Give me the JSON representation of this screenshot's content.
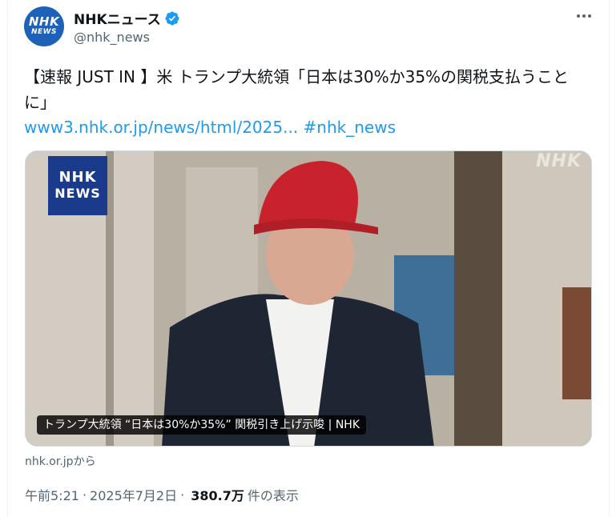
{
  "account": {
    "avatar_line1": "NHK",
    "avatar_line2": "NEWS",
    "display_name": "NHKニュース",
    "handle": "@nhk_news",
    "verified": true
  },
  "tweet": {
    "text": "【速報 JUST IN 】米 トランプ大統領「日本は30%か35%の関税支払うことに」",
    "link": "www3.nhk.or.jp/news/html/2025...",
    "hashtag": "#nhk_news"
  },
  "media": {
    "badge_line1": "NHK",
    "badge_line2": "NEWS",
    "watermark": "NHK",
    "caption": "トランプ大統領 “日本は30%か35%” 関税引き上げ示唆 | NHK",
    "source": "nhk.or.jpから"
  },
  "meta": {
    "time": "午前5:21",
    "date": "2025年7月2日",
    "views_count": "380.7万",
    "views_label": "件の表示"
  },
  "icons": {
    "verified": "verified-badge-icon",
    "more": "more-horizontal-icon"
  },
  "colors": {
    "link": "#1d9bf0",
    "verified": "#1d9bf0",
    "secondary_text": "#536471",
    "avatar_bg": "#1d62b8"
  }
}
